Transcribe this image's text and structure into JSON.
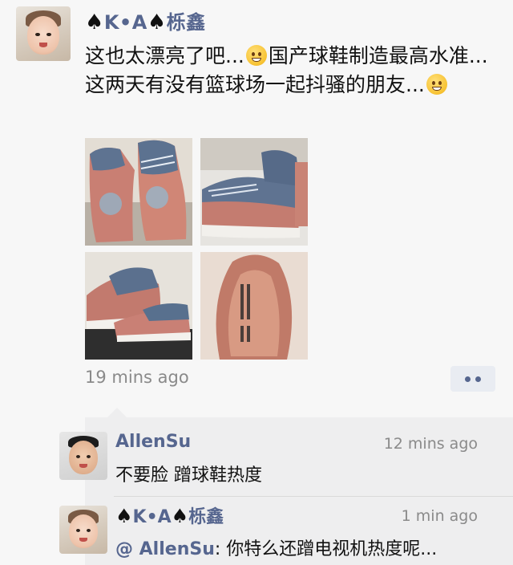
{
  "post": {
    "author_spade1": "♠",
    "author_name_a": "K•A",
    "author_spade2": "♠",
    "author_name_b": "栎鑫",
    "text_part1": "这也太漂亮了吧...",
    "text_part2": "国产球鞋制造最高水准...这两天有没有篮球场一起抖骚的朋友...",
    "emoji1": "pleading-face-emoji",
    "emoji2": "grinning-face-emoji",
    "photo_count": 4,
    "timestamp": "19 mins ago",
    "more_icon": "more-dots-icon"
  },
  "comments": [
    {
      "name": "AllenSu",
      "time": "12 mins ago",
      "text": "不要脸 蹭球鞋热度"
    },
    {
      "name_spade1": "♠",
      "name_a": "K•A",
      "name_spade2": "♠",
      "name_b": "栎鑫",
      "time": "1 min ago",
      "mention": "@ AllenSu",
      "text": ": 你特么还蹭电视机热度呢..."
    }
  ],
  "colors": {
    "name_blue": "#56668f",
    "background": "#f7f7f7",
    "comment_bg": "#eeeeef",
    "time_gray": "#8a8a8a"
  }
}
